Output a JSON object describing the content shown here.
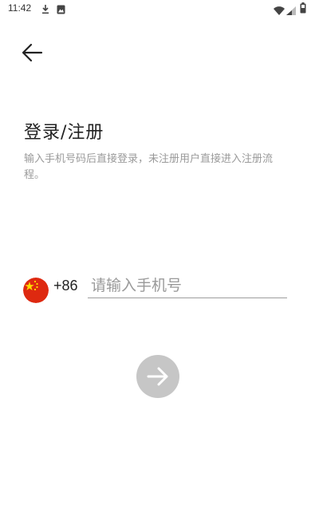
{
  "status_bar": {
    "time": "11:42",
    "icons": [
      "download-icon",
      "photo-icon",
      "wifi-icon",
      "signal-icon",
      "battery-icon"
    ]
  },
  "nav": {
    "back_icon": "arrow-left-icon"
  },
  "login": {
    "title": "登录/注册",
    "subtitle": "输入手机号码后直接登录，未注册用户直接进入注册流程。"
  },
  "phone": {
    "country_flag": "china-flag-icon",
    "country_code": "+86",
    "value": "",
    "placeholder": "请输入手机号"
  },
  "next_button": {
    "icon": "arrow-right-icon",
    "state": "disabled",
    "color": "#c6c6c6"
  },
  "colors": {
    "flag_red": "#de2910",
    "flag_star": "#ffde00",
    "subtitle_gray": "#9a9a9a"
  }
}
